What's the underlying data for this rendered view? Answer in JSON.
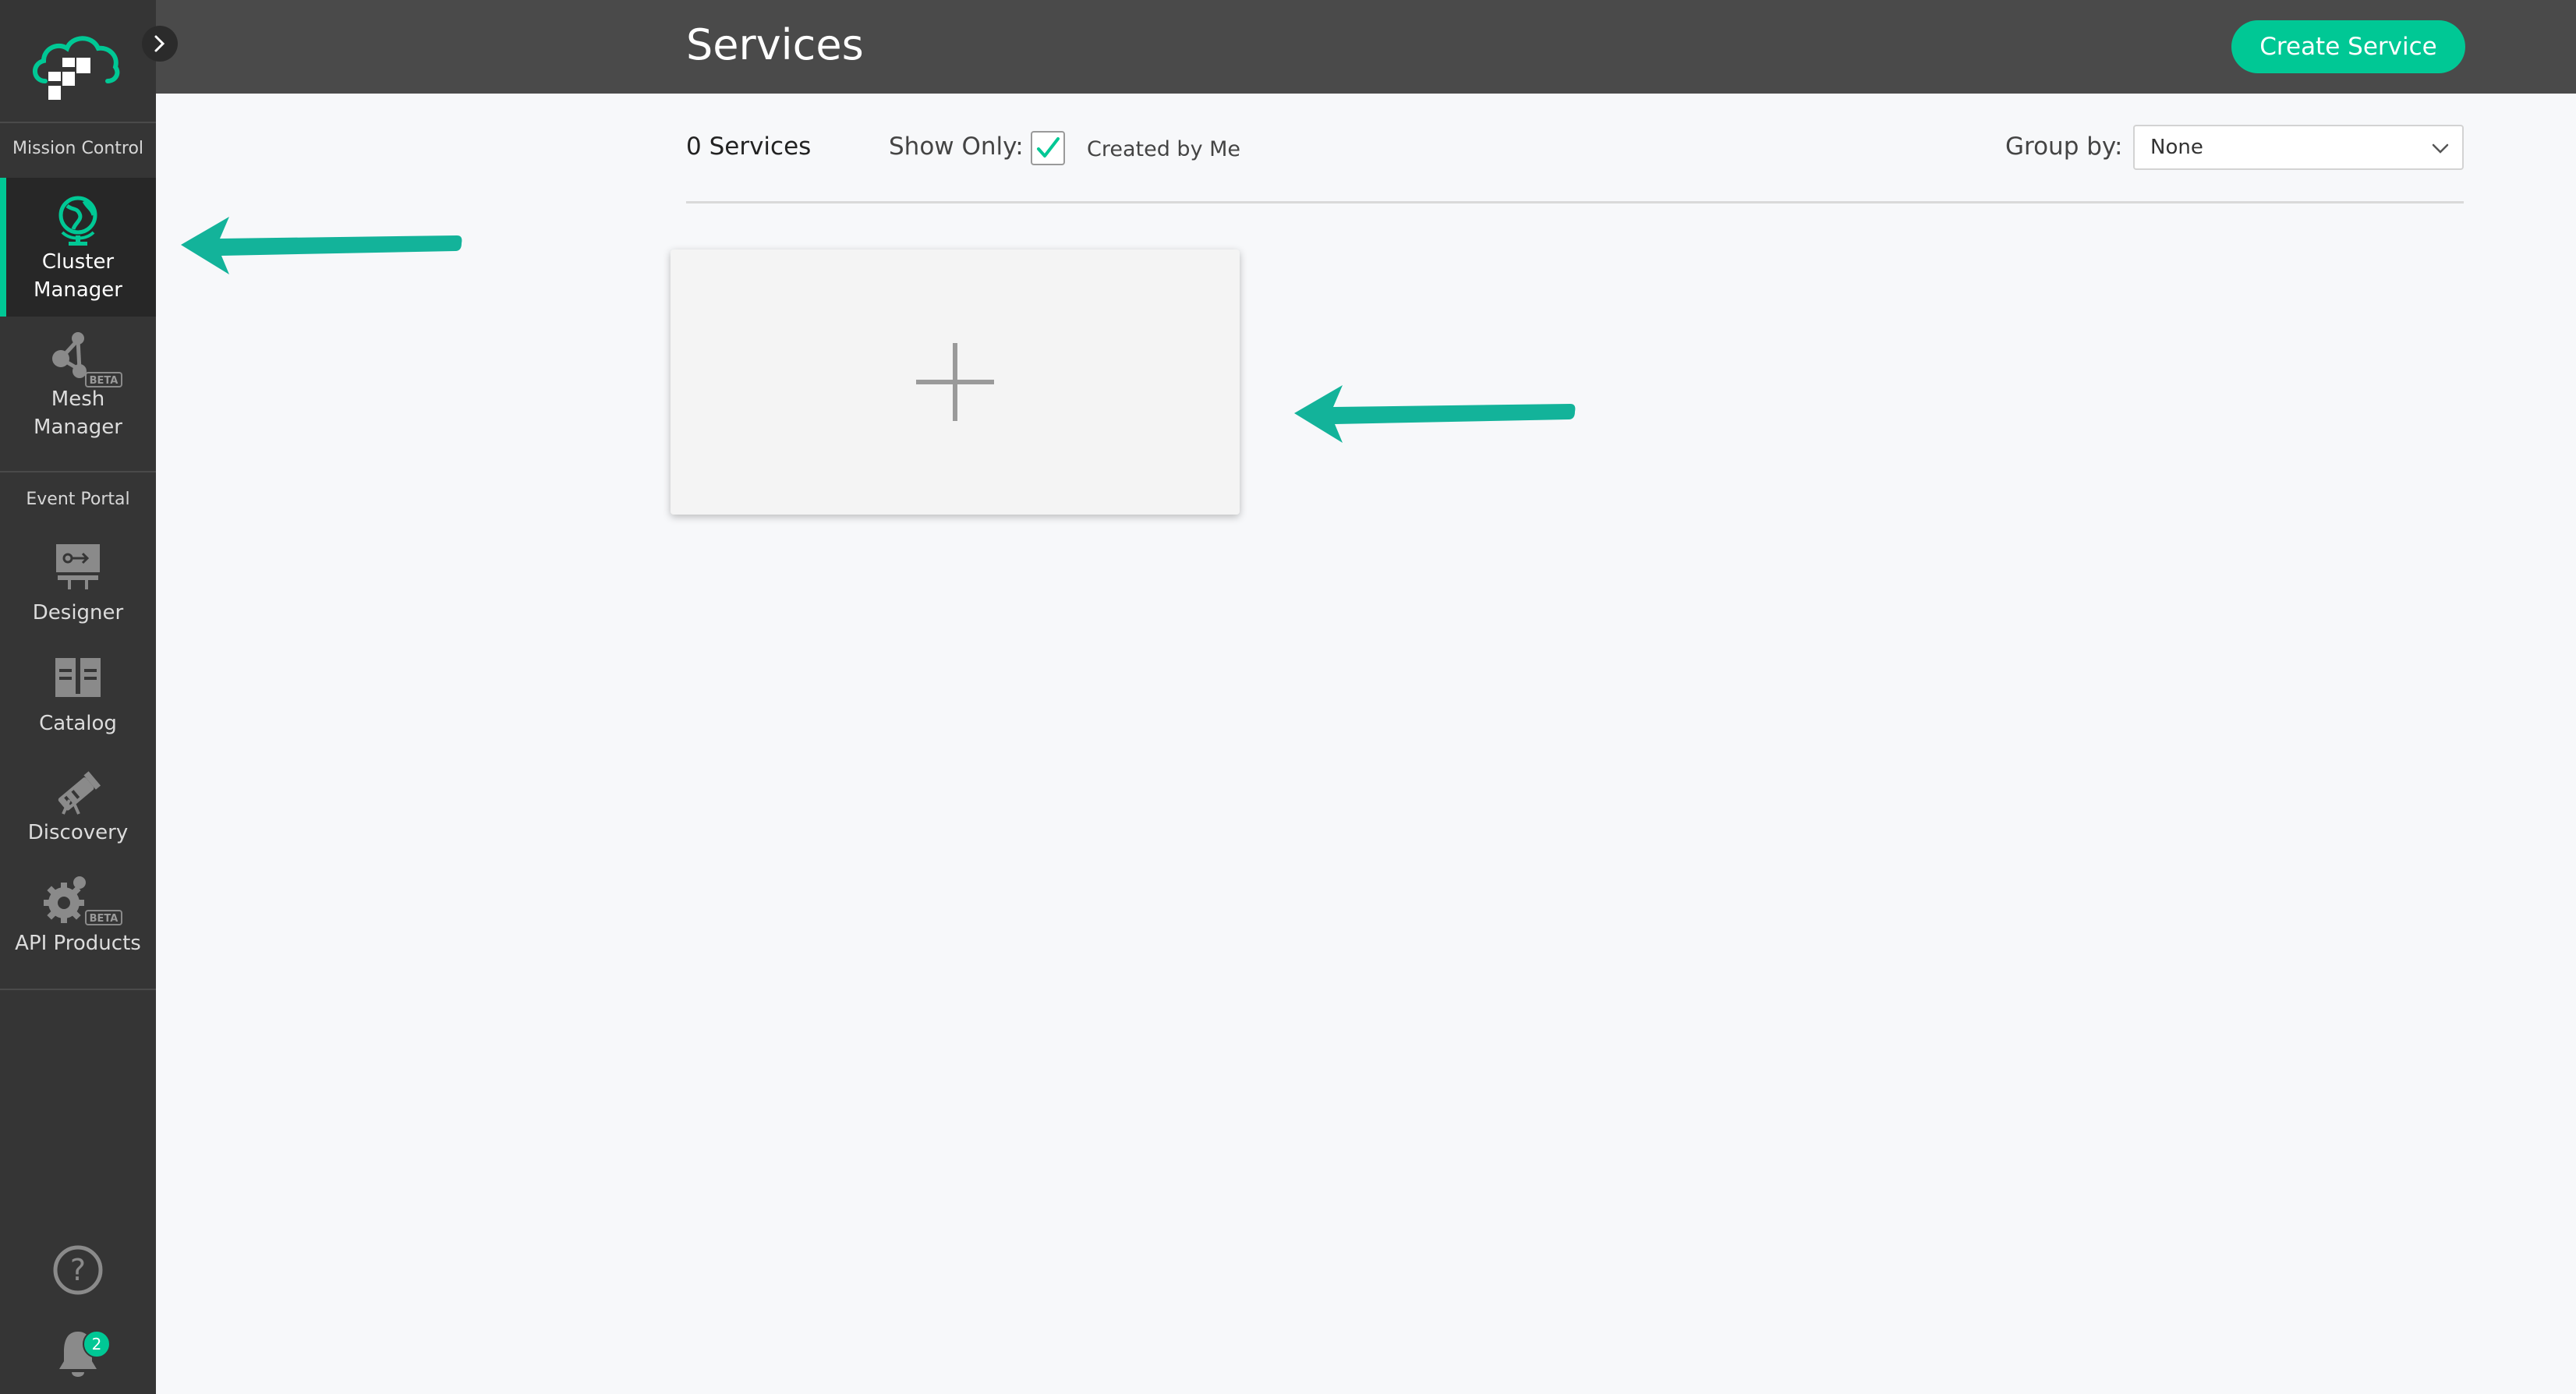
{
  "sidebar": {
    "expand_icon": "chevron-right-icon",
    "sections": {
      "mission_control": "Mission Control",
      "event_portal": "Event Portal"
    },
    "items": [
      {
        "id": "cluster-manager",
        "label_line1": "Cluster",
        "label_line2": "Manager",
        "icon": "globe-icon",
        "active": true
      },
      {
        "id": "mesh-manager",
        "label_line1": "Mesh",
        "label_line2": "Manager",
        "icon": "mesh-icon",
        "badge": "BETA"
      },
      {
        "id": "designer",
        "label": "Designer",
        "icon": "designer-icon"
      },
      {
        "id": "catalog",
        "label": "Catalog",
        "icon": "catalog-icon"
      },
      {
        "id": "discovery",
        "label": "Discovery",
        "icon": "telescope-icon"
      },
      {
        "id": "api-products",
        "label": "API Products",
        "icon": "gear-icon",
        "badge": "BETA"
      }
    ],
    "footer": {
      "help_icon": "help-icon",
      "notifications_icon": "bell-icon",
      "notification_count": "2"
    }
  },
  "header": {
    "title": "Services",
    "create_button": "Create Service"
  },
  "toolbar": {
    "services_count": "0 Services",
    "show_only_label": "Show Only:",
    "created_by_me_label": "Created by Me",
    "created_by_me_checked": true,
    "group_by_label": "Group by:",
    "group_by_value": "None"
  },
  "content": {
    "add_card_icon": "plus-icon"
  },
  "colors": {
    "accent": "#00c895",
    "annotation_arrow": "#13b39a",
    "sidebar_bg": "#353535",
    "header_bg": "#4a4a4a"
  }
}
